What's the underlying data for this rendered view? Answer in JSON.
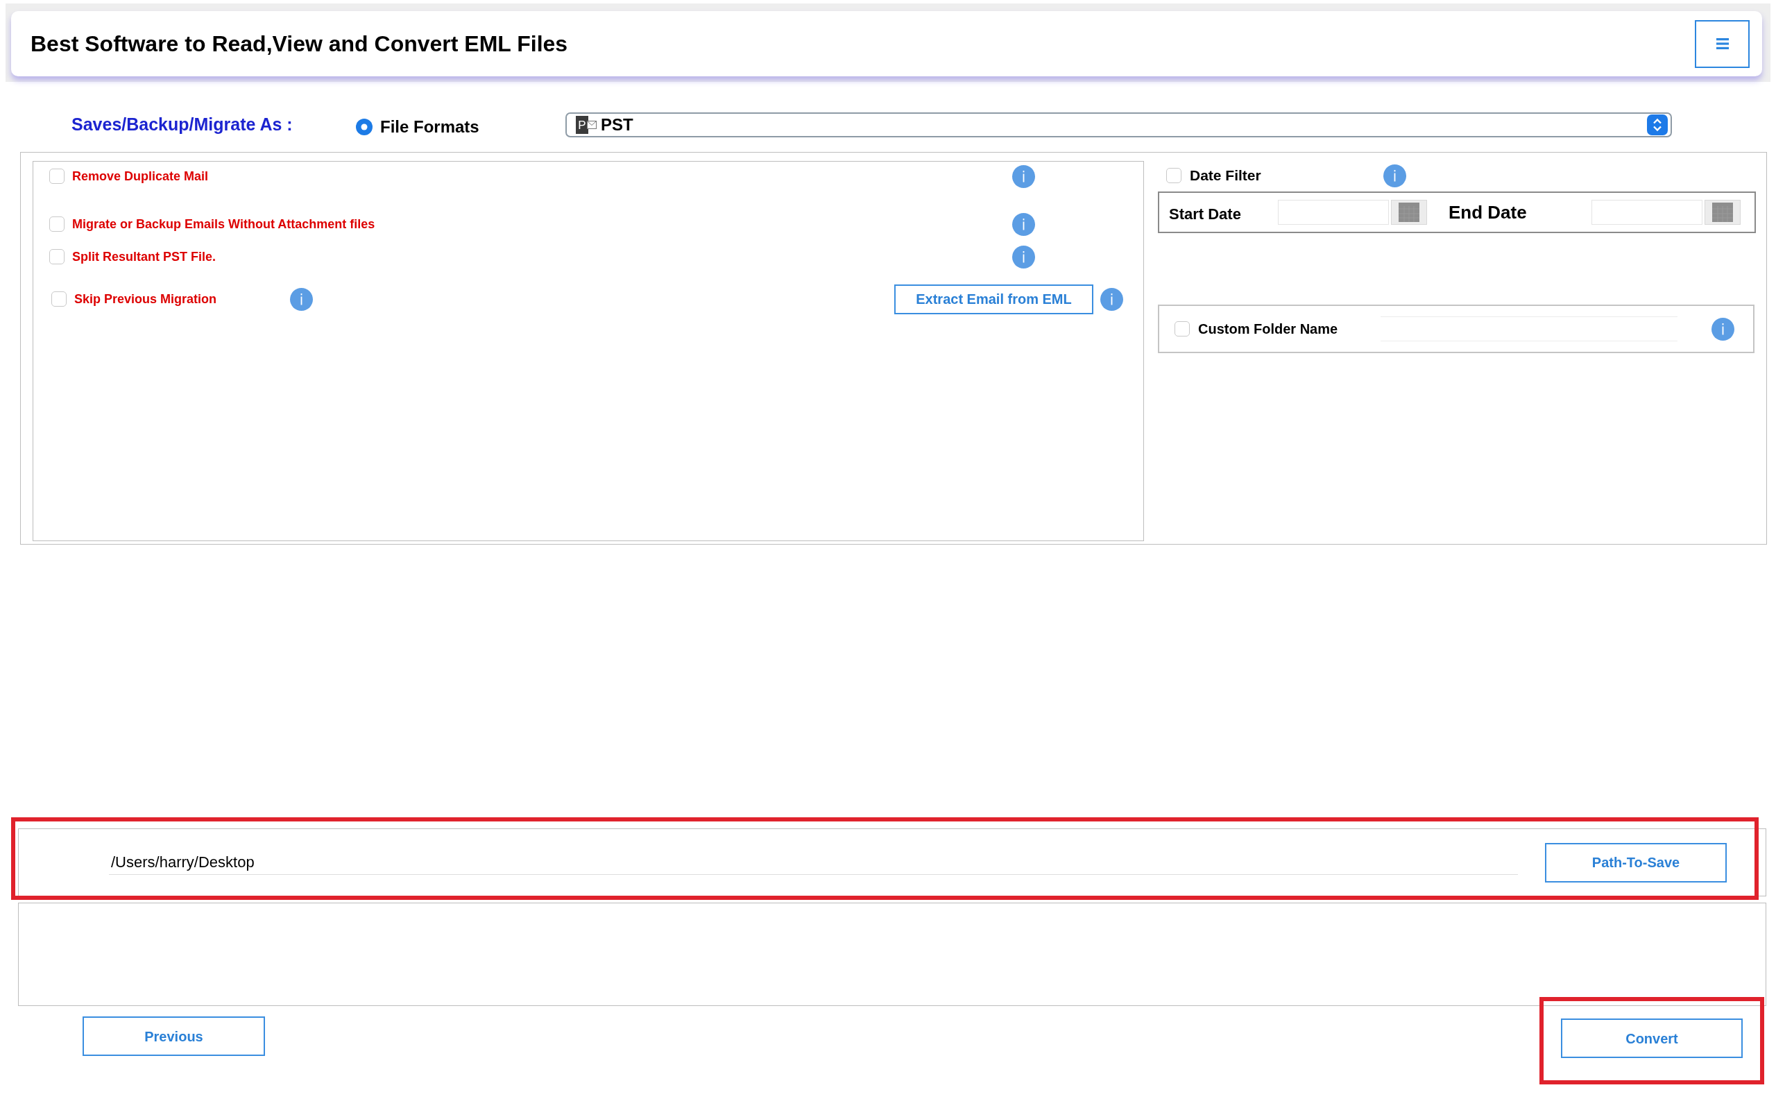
{
  "header": {
    "title": "Best Software to Read,View and Convert EML Files"
  },
  "save_as": {
    "label": "Saves/Backup/Migrate As :",
    "option": {
      "label": "File Formats",
      "selected": true
    },
    "format_select": {
      "icon_letter": "P",
      "value": "PST"
    }
  },
  "options": [
    {
      "label": "Remove Duplicate Mail",
      "checked": false
    },
    {
      "label": "Migrate or Backup Emails Without Attachment files",
      "checked": false
    },
    {
      "label": "Split Resultant PST File.",
      "checked": false
    }
  ],
  "skip_migration": {
    "label": "Skip Previous Migration",
    "checked": false
  },
  "extract_button": "Extract Email from EML",
  "date_filter": {
    "label": "Date Filter",
    "checked": false,
    "start_label": "Start Date",
    "end_label": "End Date"
  },
  "custom_folder": {
    "label": "Custom Folder Name",
    "checked": false
  },
  "destination": {
    "path": "/Users/harry/Desktop",
    "button": "Path-To-Save",
    "highlighted": true
  },
  "footer": {
    "previous": "Previous",
    "convert": {
      "label": "Convert",
      "highlighted": true
    }
  }
}
